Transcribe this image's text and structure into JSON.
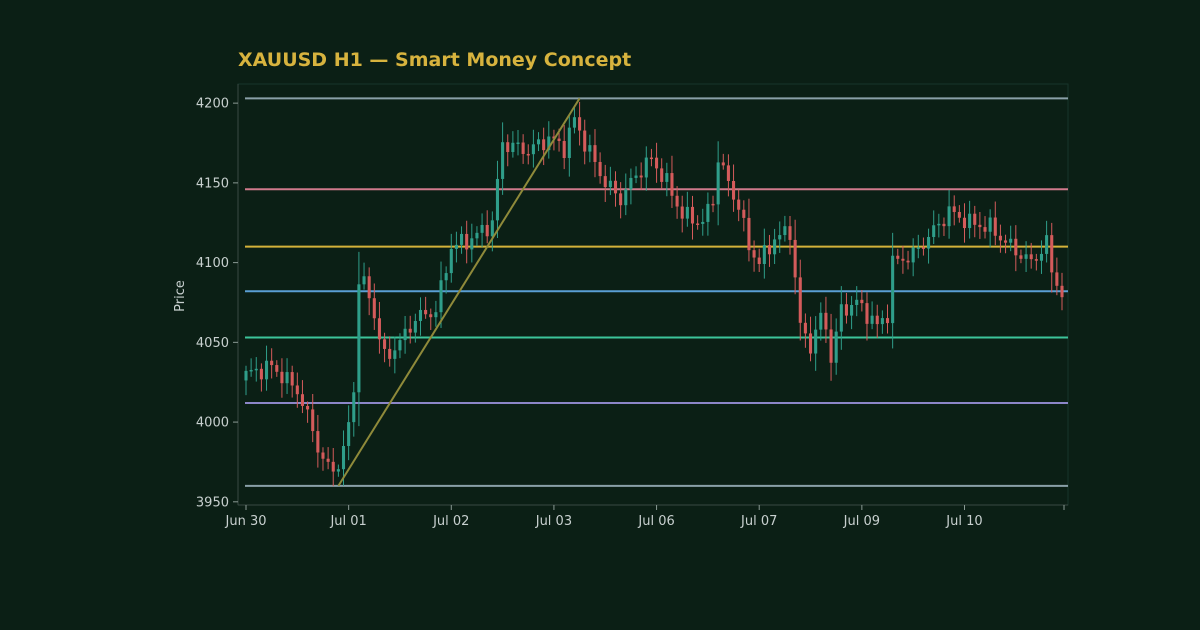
{
  "chart_data": {
    "type": "candlestick",
    "title": "XAUUSD H1 — Smart Money Concept",
    "ylabel": "Price",
    "xlabel": "",
    "ylim": [
      3948,
      4212
    ],
    "yticks": [
      3950,
      4000,
      4050,
      4100,
      4150,
      4200
    ],
    "xticks": [
      {
        "label": "Jun 30",
        "index": 0
      },
      {
        "label": "Jul 01",
        "index": 20
      },
      {
        "label": "Jul 02",
        "index": 40
      },
      {
        "label": "Jul 03",
        "index": 60
      },
      {
        "label": "Jul 06",
        "index": 80
      },
      {
        "label": "Jul 07",
        "index": 100
      },
      {
        "label": "Jul 09",
        "index": 120
      },
      {
        "label": "Jul 10",
        "index": 140
      }
    ],
    "candle_count": 160,
    "grid": false,
    "levels": [
      {
        "price": 4203,
        "color": "#8aa0a8"
      },
      {
        "price": 4146,
        "color": "#d07a8c"
      },
      {
        "price": 4110,
        "color": "#d4b23a"
      },
      {
        "price": 4082,
        "color": "#5a9fd4"
      },
      {
        "price": 4053,
        "color": "#3cc49a"
      },
      {
        "price": 4012,
        "color": "#8c86c8"
      },
      {
        "price": 3960,
        "color": "#8aa0a8"
      }
    ],
    "trendline": {
      "start": {
        "index": 18,
        "price": 3960
      },
      "end": {
        "index": 65,
        "price": 4203
      },
      "color": "#8f8a3a"
    },
    "anchors": [
      [
        0,
        4030
      ],
      [
        5,
        4035
      ],
      [
        10,
        4020
      ],
      [
        13,
        3995
      ],
      [
        15,
        3975
      ],
      [
        17,
        3970
      ],
      [
        19,
        3980
      ],
      [
        21,
        4020
      ],
      [
        22,
        4090
      ],
      [
        24,
        4080
      ],
      [
        27,
        4040
      ],
      [
        30,
        4050
      ],
      [
        33,
        4065
      ],
      [
        37,
        4070
      ],
      [
        40,
        4110
      ],
      [
        44,
        4115
      ],
      [
        48,
        4125
      ],
      [
        50,
        4175
      ],
      [
        55,
        4170
      ],
      [
        59,
        4178
      ],
      [
        62,
        4172
      ],
      [
        64,
        4190
      ],
      [
        66,
        4175
      ],
      [
        70,
        4150
      ],
      [
        73,
        4140
      ],
      [
        76,
        4155
      ],
      [
        79,
        4165
      ],
      [
        82,
        4150
      ],
      [
        85,
        4130
      ],
      [
        89,
        4125
      ],
      [
        91,
        4140
      ],
      [
        92,
        4165
      ],
      [
        94,
        4150
      ],
      [
        96,
        4135
      ],
      [
        98,
        4110
      ],
      [
        100,
        4100
      ],
      [
        103,
        4115
      ],
      [
        106,
        4120
      ],
      [
        107,
        4090
      ],
      [
        108,
        4060
      ],
      [
        110,
        4048
      ],
      [
        112,
        4065
      ],
      [
        113,
        4060
      ],
      [
        114,
        4040
      ],
      [
        116,
        4070
      ],
      [
        119,
        4075
      ],
      [
        121,
        4068
      ],
      [
        123,
        4060
      ],
      [
        125,
        4068
      ],
      [
        126,
        4100
      ],
      [
        130,
        4105
      ],
      [
        134,
        4120
      ],
      [
        137,
        4132
      ],
      [
        141,
        4125
      ],
      [
        145,
        4122
      ],
      [
        149,
        4110
      ],
      [
        153,
        4100
      ],
      [
        156,
        4112
      ],
      [
        157,
        4095
      ],
      [
        159,
        4080
      ],
      [
        161,
        4070
      ],
      [
        163,
        4060
      ]
    ],
    "colors": {
      "up": "#2f9e8a",
      "down": "#d45b5b"
    }
  }
}
